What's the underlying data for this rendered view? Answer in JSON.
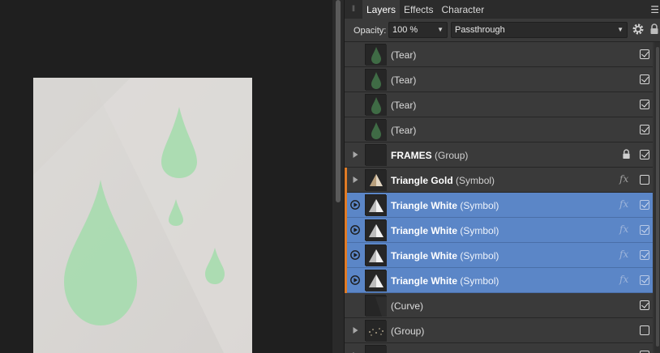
{
  "panel": {
    "tabs": [
      {
        "label": "Layers",
        "active": true
      },
      {
        "label": "Effects",
        "active": false
      },
      {
        "label": "Character",
        "active": false
      }
    ],
    "opacity_label": "Opacity:",
    "opacity_value": "100 %",
    "blend_mode": "Passthrough"
  },
  "layers": [
    {
      "name": "(Tear)",
      "kind": "",
      "visible": true,
      "selected": false,
      "expandable": false,
      "fx": false,
      "locked": false,
      "thumb": "tear"
    },
    {
      "name": "(Tear)",
      "kind": "",
      "visible": true,
      "selected": false,
      "expandable": false,
      "fx": false,
      "locked": false,
      "thumb": "tear"
    },
    {
      "name": "(Tear)",
      "kind": "",
      "visible": true,
      "selected": false,
      "expandable": false,
      "fx": false,
      "locked": false,
      "thumb": "tear"
    },
    {
      "name": "(Tear)",
      "kind": "",
      "visible": true,
      "selected": false,
      "expandable": false,
      "fx": false,
      "locked": false,
      "thumb": "tear"
    },
    {
      "name": "FRAMES",
      "kind": "(Group)",
      "visible": true,
      "selected": false,
      "expandable": true,
      "fx": false,
      "locked": true,
      "thumb": "empty"
    },
    {
      "name": "Triangle Gold",
      "kind": "(Symbol)",
      "visible": false,
      "selected": false,
      "expandable": true,
      "fx": true,
      "locked": false,
      "thumb": "triangle-gold",
      "orange": true
    },
    {
      "name": "Triangle White",
      "kind": "(Symbol)",
      "visible": true,
      "selected": true,
      "expandable": true,
      "fx": true,
      "locked": false,
      "thumb": "triangle-white",
      "orange": true
    },
    {
      "name": "Triangle White",
      "kind": "(Symbol)",
      "visible": true,
      "selected": true,
      "expandable": true,
      "fx": true,
      "locked": false,
      "thumb": "triangle-white",
      "orange": true
    },
    {
      "name": "Triangle White",
      "kind": "(Symbol)",
      "visible": true,
      "selected": true,
      "expandable": true,
      "fx": true,
      "locked": false,
      "thumb": "triangle-white",
      "orange": true
    },
    {
      "name": "Triangle White",
      "kind": "(Symbol)",
      "visible": true,
      "selected": true,
      "expandable": true,
      "fx": true,
      "locked": false,
      "thumb": "triangle-white",
      "orange": true
    },
    {
      "name": "(Curve)",
      "kind": "",
      "visible": true,
      "selected": false,
      "expandable": false,
      "fx": false,
      "locked": false,
      "thumb": "curve"
    },
    {
      "name": "(Group)",
      "kind": "",
      "visible": false,
      "selected": false,
      "expandable": true,
      "fx": false,
      "locked": false,
      "thumb": "stars"
    },
    {
      "name": "",
      "kind": "",
      "visible": false,
      "selected": false,
      "expandable": true,
      "fx": false,
      "locked": false,
      "thumb": "empty"
    }
  ],
  "fx_label": "fx",
  "colors": {
    "selection": "#5b86c7",
    "accent_orange": "#e07b25",
    "tear_green": "#a6dcae",
    "artboard": "#d9d6d3"
  }
}
